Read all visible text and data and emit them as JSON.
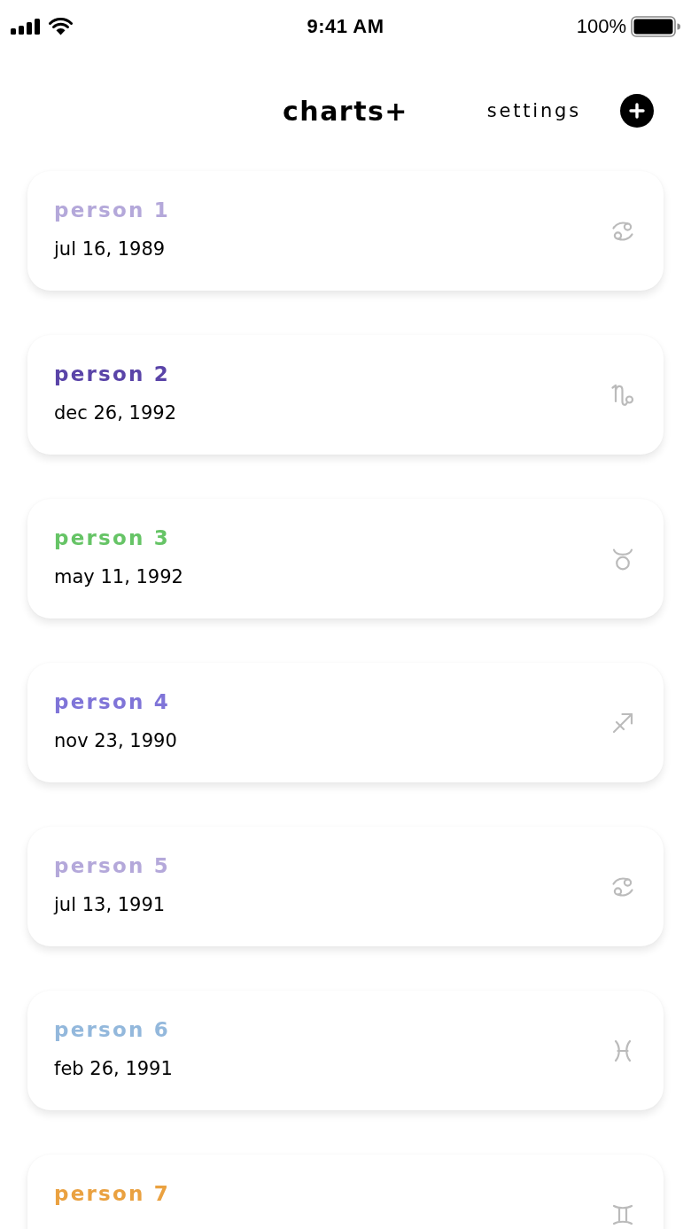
{
  "status_bar": {
    "time": "9:41 AM",
    "battery": "100%"
  },
  "nav": [
    {
      "label": "charts+",
      "selected": true
    },
    {
      "label": "settings",
      "selected": false
    }
  ],
  "people": [
    {
      "name": "person 1",
      "color": "#b4a8da",
      "date": "jul 16, 1989",
      "kind": "cancer"
    },
    {
      "name": "person 2",
      "color": "#5a44a8",
      "date": "dec 26, 1992",
      "kind": "capricorn"
    },
    {
      "name": "person 3",
      "color": "#66c466",
      "date": "may 11, 1992",
      "kind": "taurus"
    },
    {
      "name": "person 4",
      "color": "#7f74d8",
      "date": "nov 23, 1990",
      "kind": "sagittarius"
    },
    {
      "name": "person 5",
      "color": "#b4a8da",
      "date": "jul 13, 1991",
      "kind": "cancer"
    },
    {
      "name": "person 6",
      "color": "#93b8dc",
      "date": "feb 26, 1991",
      "kind": "pisces"
    },
    {
      "name": "person 7",
      "color": "#eaa140",
      "kind": "gemini"
    }
  ]
}
